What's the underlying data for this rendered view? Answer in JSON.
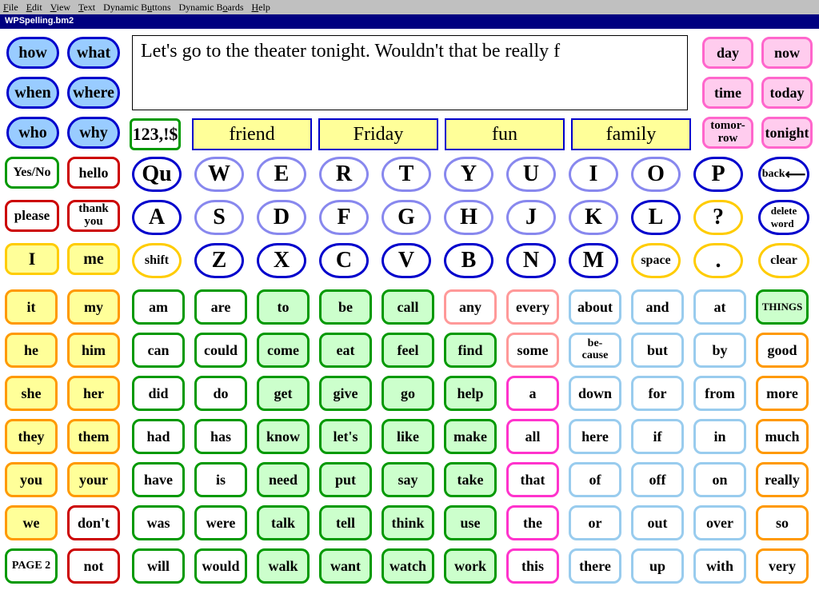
{
  "menu": {
    "file": "File",
    "edit": "Edit",
    "view": "View",
    "text": "Text",
    "dynbtn": "Dynamic Buttons",
    "dynbrd": "Dynamic Boards",
    "help": "Help"
  },
  "title": "WPSpelling.bm2",
  "output": "Let's go to the theater tonight.  Wouldn't that be really f",
  "wh": {
    "how": "how",
    "what": "what",
    "when": "when",
    "where": "where",
    "who": "who",
    "why": "why"
  },
  "right_top": {
    "day": "day",
    "now": "now",
    "time": "time",
    "today": "today",
    "tomorrow": "tomor-\nrow",
    "tonight": "tonight"
  },
  "phrase": {
    "yesno": "Yes/No",
    "hello": "hello",
    "please": "please",
    "thank": "thank\nyou",
    "I": "I",
    "me": "me"
  },
  "sym": "123,!$",
  "predictions": {
    "p1": "friend",
    "p2": "Friday",
    "p3": "fun",
    "p4": "family"
  },
  "keys": {
    "Qu": "Qu",
    "W": "W",
    "E": "E",
    "R": "R",
    "T": "T",
    "Y": "Y",
    "U": "U",
    "I": "I",
    "O": "O",
    "P": "P",
    "A": "A",
    "S": "S",
    "D": "D",
    "F": "F",
    "G": "G",
    "H": "H",
    "J": "J",
    "K": "K",
    "L": "L",
    "Z": "Z",
    "X": "X",
    "C": "C",
    "V": "V",
    "B": "B",
    "N": "N",
    "M": "M",
    "shift": "shift",
    "space": "space",
    "q": "?",
    "period": ".",
    "back": "back",
    "delword": "delete\nword",
    "clear": "clear"
  },
  "col1": {
    "it": "it",
    "he": "he",
    "she": "she",
    "they": "they",
    "you": "you",
    "we": "we",
    "page2": "PAGE 2"
  },
  "col2": {
    "my": "my",
    "him": "him",
    "her": "her",
    "them": "them",
    "your": "your",
    "dont": "don't",
    "not": "not"
  },
  "col3": {
    "am": "am",
    "can": "can",
    "did": "did",
    "had": "had",
    "have": "have",
    "was": "was",
    "will": "will"
  },
  "col4": {
    "are": "are",
    "could": "could",
    "do": "do",
    "has": "has",
    "is": "is",
    "were": "were",
    "would": "would"
  },
  "col5": {
    "to": "to",
    "come": "come",
    "get": "get",
    "know": "know",
    "need": "need",
    "talk": "talk",
    "walk": "walk"
  },
  "col6": {
    "be": "be",
    "eat": "eat",
    "give": "give",
    "lets": "let's",
    "put": "put",
    "tell": "tell",
    "want": "want"
  },
  "col7": {
    "call": "call",
    "feel": "feel",
    "go": "go",
    "like": "like",
    "say": "say",
    "think": "think",
    "watch": "watch"
  },
  "col8": {
    "any": "any",
    "find": "find",
    "help": "help",
    "make": "make",
    "take": "take",
    "use": "use",
    "work": "work"
  },
  "col9": {
    "every": "every",
    "some": "some",
    "a": "a",
    "all": "all",
    "that": "that",
    "the": "the",
    "this": "this"
  },
  "col10": {
    "about": "about",
    "because": "be-\ncause",
    "down": "down",
    "here": "here",
    "of": "of",
    "or": "or",
    "there": "there"
  },
  "col11": {
    "and": "and",
    "but": "but",
    "for": "for",
    "if": "if",
    "off": "off",
    "out": "out",
    "up": "up"
  },
  "col12": {
    "at": "at",
    "by": "by",
    "from": "from",
    "in": "in",
    "on": "on",
    "over": "over",
    "with": "with"
  },
  "col13": {
    "things": "THINGS",
    "good": "good",
    "more": "more",
    "much": "much",
    "really": "really",
    "so": "so",
    "very": "very"
  }
}
